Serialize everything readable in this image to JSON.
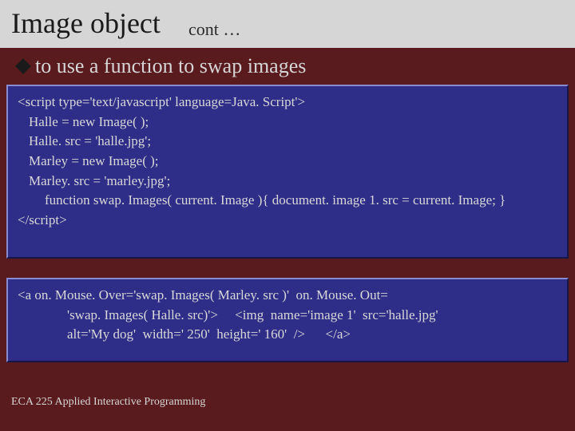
{
  "title": "Image object",
  "cont": "cont …",
  "bullet": "to use a function to swap images",
  "code1": {
    "l1": "<script type='text/javascript' language=Java. Script'>",
    "l2": "Halle = new Image( );",
    "l3": "Halle. src = 'halle.jpg';",
    "l4": "Marley = new Image( );",
    "l5": "Marley. src = 'marley.jpg';",
    "l6": "function swap. Images( current. Image ){ document. image 1. src = current. Image; }",
    "l7": "</script>"
  },
  "code2": {
    "l1": "<a on. Mouse. Over='swap. Images( Marley. src )'  on. Mouse. Out=",
    "l2": "'swap. Images( Halle. src)'>     <img  name='image 1'  src='halle.jpg'",
    "l3": "alt='My dog'  width=' 250'  height=' 160'  />      </a>"
  },
  "footer": "ECA 225   Applied Interactive Programming"
}
